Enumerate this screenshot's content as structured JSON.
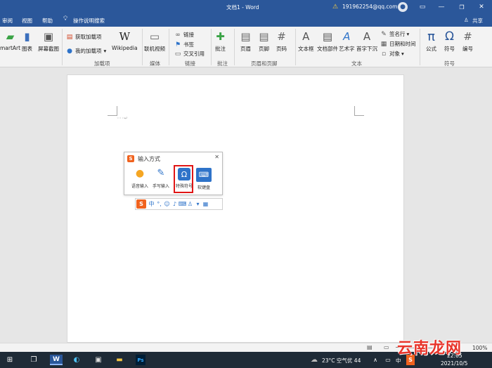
{
  "titlebar": {
    "doc_title": "文档1 - Word",
    "account": "191962254@qq.com",
    "warning_icon": "warning-icon"
  },
  "tabs": {
    "review": "审阅",
    "view": "视图",
    "help": "帮助",
    "search": "操作说明搜索",
    "share": "共享"
  },
  "ribbon": {
    "smartart": "martArt",
    "chart": "图表",
    "screenshot": "屏幕截图",
    "get_addins": "获取加载项",
    "my_addins": "我的加载项",
    "wikipedia": "Wikipedia",
    "online_video": "联机视频",
    "link": "链接",
    "bookmark": "书签",
    "crossref": "交叉引用",
    "comment": "批注",
    "header": "页眉",
    "footer": "页脚",
    "page_number": "页码",
    "textbox": "文本框",
    "quickparts": "文档部件",
    "wordart": "艺术字",
    "dropcap": "首字下沉",
    "signature": "签名行",
    "datetime": "日期和时间",
    "object": "对象",
    "equation": "公式",
    "symbol": "符号",
    "number": "编号",
    "groups": {
      "addins": "加载项",
      "media": "媒体",
      "links": "链接",
      "comments": "批注",
      "headerfooter": "页眉和页脚",
      "text": "文本",
      "symbols": "符号"
    }
  },
  "ime_panel": {
    "title": "输入方式",
    "voice": "语音输入",
    "handwrite": "手写输入",
    "special": "特殊符号",
    "softkb": "软键盘",
    "toolbar_zh": "中"
  },
  "statusbar": {
    "zoom": "100%"
  },
  "taskbar": {
    "weather": "23°C 空气优 44",
    "lang": "中",
    "time": "22:05",
    "date": "2021/10/5"
  },
  "watermark": "云南龙网",
  "colors": {
    "word_blue": "#2b579a",
    "accent": "#2e73c9",
    "highlight_red": "#e01515",
    "taskbar": "#1f2b37"
  }
}
